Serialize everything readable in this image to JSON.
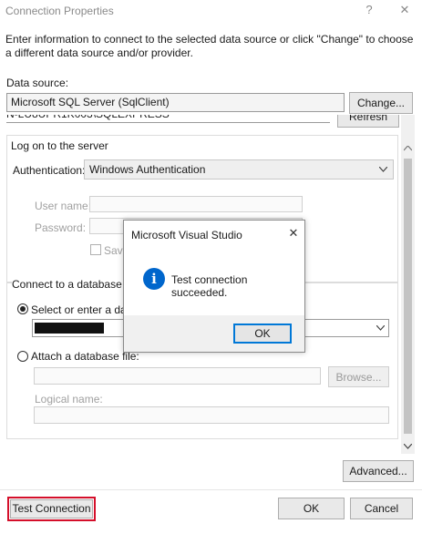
{
  "window": {
    "title": "Connection Properties",
    "help_label": "?",
    "close_label": "✕"
  },
  "intro_text": "Enter information to connect to the selected data source or click \"Change\" to choose a different data source and/or provider.",
  "data_source": {
    "label": "Data source:",
    "value": "Microsoft SQL Server (SqlClient)",
    "change_button": "Change..."
  },
  "server": {
    "value_partial": "N-LU8UPR1K003\\SQLEXPRESS",
    "refresh_button": "Refresh"
  },
  "logon": {
    "group_label": "Log on to the server",
    "auth_label": "Authentication:",
    "auth_value": "Windows Authentication",
    "username_label": "User name:",
    "password_label": "Password:",
    "save_password_label": "Save"
  },
  "database": {
    "group_label": "Connect to a database",
    "select_label": "Select or enter a databa",
    "attach_label": "Attach a database file:",
    "browse_button": "Browse...",
    "logical_name_label": "Logical name:"
  },
  "advanced_button": "Advanced...",
  "footer": {
    "test_connection_button": "Test Connection",
    "ok_button": "OK",
    "cancel_button": "Cancel"
  },
  "modal": {
    "title": "Microsoft Visual Studio",
    "close_label": "✕",
    "message": "Test connection succeeded.",
    "icon_glyph": "i",
    "ok_button": "OK"
  },
  "colors": {
    "accent": "#0078d7",
    "info_icon": "#0066cc",
    "highlight": "#d40f2a"
  },
  "icons": [
    "help-icon",
    "close-icon",
    "chevron-down-icon",
    "info-icon",
    "scroll-up-icon",
    "scroll-down-icon"
  ]
}
